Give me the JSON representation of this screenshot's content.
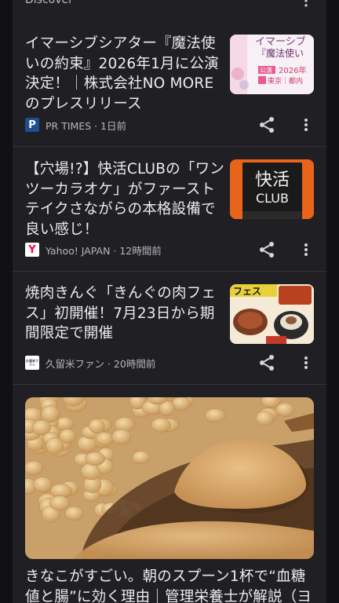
{
  "section": {
    "title": "Discover"
  },
  "articles": [
    {
      "title": "イマーシブシアター『魔法使いの約束』2026年1月に公演決定！｜株式会社NO MOREのプレスリリース",
      "source": "PR TIMES",
      "time": "1日前",
      "meta": "PR TIMES · 1日前",
      "favicon_letter": "P",
      "thumb_text_1": "イマーシブ",
      "thumb_text_2": "『魔法使い",
      "thumb_text_3": "2026年",
      "thumb_text_4": "東京｜都内",
      "thumb_badge": "公演"
    },
    {
      "title": "【穴場!?】快活CLUBの「ワンツーカラオケ」がファーストテイクさながらの本格設備で良い感じ！",
      "source": "Yahoo! JAPAN",
      "time": "12時間前",
      "meta": "Yahoo! JAPAN · 12時間前",
      "favicon_letter": "Y",
      "thumb_text_1": "快活",
      "thumb_text_2": "CLUB"
    },
    {
      "title": "焼肉きんぐ「きんぐの肉フェス」初開催！7月23日から期間限定で開催",
      "source": "久留米ファン",
      "time": "20時間前",
      "meta": "久留米ファン · 20時間前",
      "favicon_letter": "久留米ファン",
      "thumb_text_1": "フェス"
    },
    {
      "title": "きなこがすごい。朝のスプーン1杯で“血糖値と腸”に効く理由｜管理栄養士が解説（ヨガ"
    }
  ],
  "colors": {
    "background": "#111114",
    "card": "#1f1f24",
    "text": "#ececf0",
    "meta": "#b6b6be",
    "divider": "#34343b",
    "prtimes": "#1e4f8f",
    "yahoo": "#ff0033"
  },
  "icons": {
    "share": "share-icon",
    "more": "more-vert-icon"
  }
}
